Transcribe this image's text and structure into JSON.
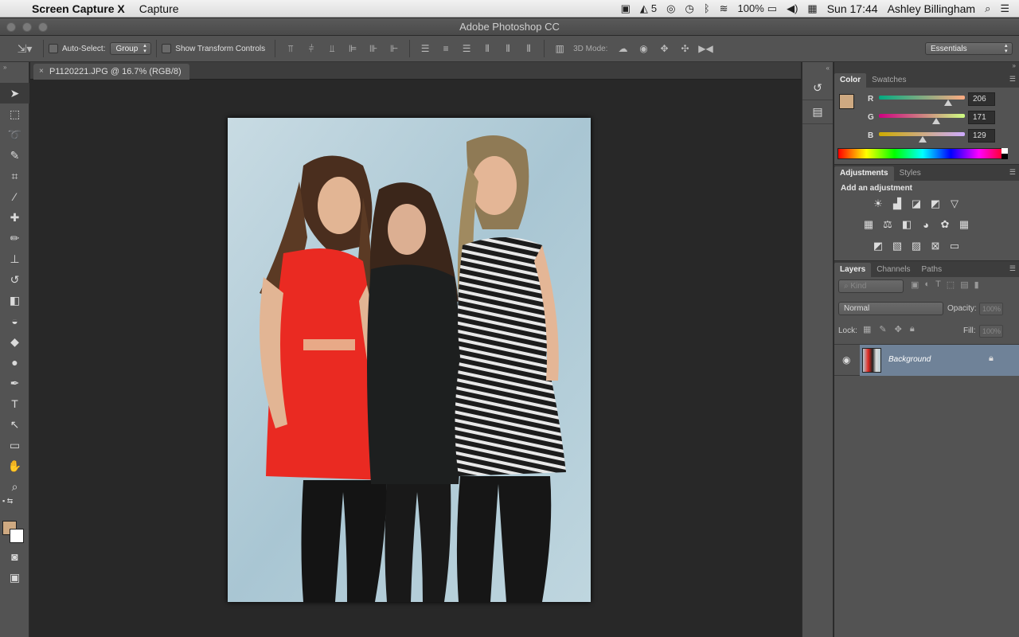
{
  "menubar": {
    "app_name": "Screen Capture X",
    "menu_capture": "Capture",
    "tray_count": "5",
    "battery": "100%",
    "clock": "Sun 17:44",
    "user": "Ashley Billingham"
  },
  "window": {
    "title": "Adobe Photoshop CC"
  },
  "options": {
    "auto_select_label": "Auto-Select:",
    "auto_select_value": "Group",
    "show_transform_label": "Show Transform Controls",
    "mode_3d_label": "3D Mode:",
    "workspace": "Essentials"
  },
  "document": {
    "tab_title": "P1120221.JPG @ 16.7% (RGB/8)",
    "close_glyph": "×"
  },
  "color_panel": {
    "tabs": [
      "Color",
      "Swatches"
    ],
    "foreground_hex": "#cea981",
    "r_label": "R",
    "g_label": "G",
    "b_label": "B",
    "r": 206,
    "g": 171,
    "b": 129
  },
  "adjustments_panel": {
    "tabs": [
      "Adjustments",
      "Styles"
    ],
    "heading": "Add an adjustment"
  },
  "layers_panel": {
    "tabs": [
      "Layers",
      "Channels",
      "Paths"
    ],
    "filter_kind": "Kind",
    "blend_mode": "Normal",
    "opacity_label": "Opacity:",
    "opacity_value": "100%",
    "lock_label": "Lock:",
    "fill_label": "Fill:",
    "fill_value": "100%",
    "layers": [
      {
        "name": "Background",
        "visible": true,
        "locked": true
      }
    ]
  },
  "icons": {
    "apple": "apple-logo-icon",
    "move_tool": "move-tool-icon",
    "type_tool_glyph": "T"
  }
}
